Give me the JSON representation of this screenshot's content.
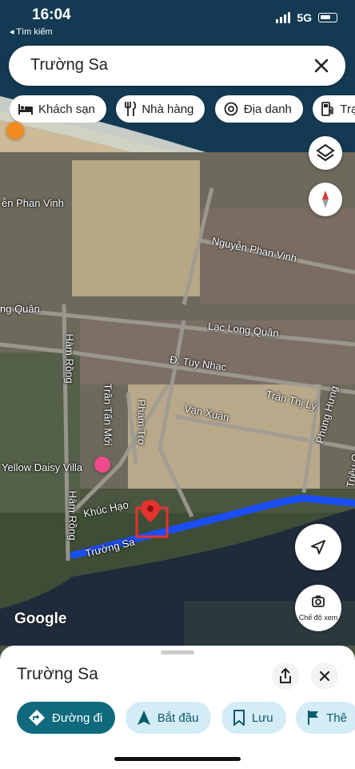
{
  "status_bar": {
    "time": "16:04",
    "back_label": "◂ Tìm kiếm",
    "network": "5G"
  },
  "search": {
    "query": "Trường Sa",
    "clear_icon": "close-icon"
  },
  "categories": [
    {
      "label": "Khách sạn",
      "icon": "bed-icon"
    },
    {
      "label": "Nhà hàng",
      "icon": "restaurant-icon"
    },
    {
      "label": "Địa danh",
      "icon": "landmark-icon"
    },
    {
      "label": "Trạm",
      "icon": "gas-station-icon"
    }
  ],
  "map": {
    "street_labels": [
      "ễn Phan Vinh",
      "Nguyễn Phan Vinh",
      "ng Quân",
      "Lạc Long Quân",
      "Hàm Rồng",
      "Đ. Tuy Nhạc",
      "Trần Tấn Mới",
      "Phạm Trợ",
      "Trần Thị Lý",
      "Vạn Xuân",
      "Phùng Hưng",
      "Yellow Daisy Villa",
      "Hàm Rồng",
      "Khúc Hạo",
      "Trường Sa",
      "Triệu Q"
    ],
    "watermark": "Google",
    "view_mode_label": "Chế độ xem",
    "route_color": "#1a4ef5",
    "marker_color": "#e5322d"
  },
  "sheet": {
    "title": "Trường Sa",
    "actions": [
      {
        "label": "Đường đi",
        "icon": "directions-icon",
        "primary": true
      },
      {
        "label": "Bắt đầu",
        "icon": "navigation-arrow-icon",
        "primary": false
      },
      {
        "label": "Lưu",
        "icon": "bookmark-icon",
        "primary": false
      },
      {
        "label": "Thê",
        "icon": "flag-icon",
        "primary": false
      }
    ]
  }
}
